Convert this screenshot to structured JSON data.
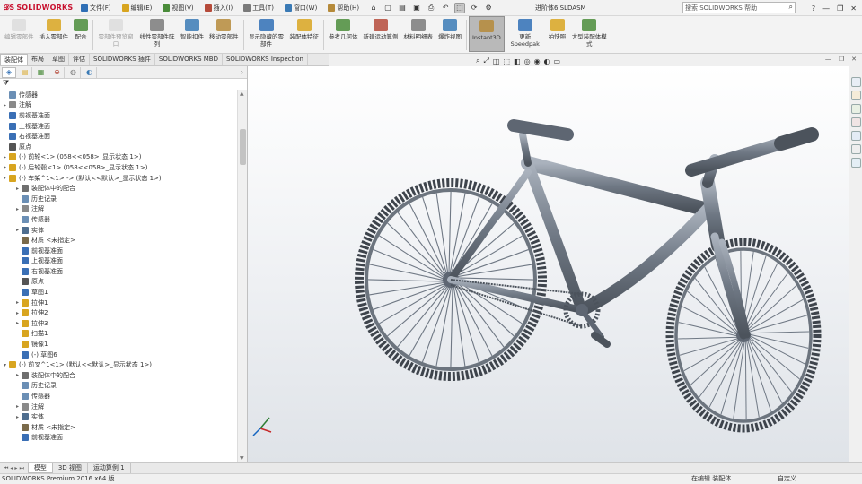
{
  "app": {
    "logo": "SOLIDWORKS",
    "doc_title": "进阶体6.SLDASM",
    "search_placeholder": "搜索 SOLIDWORKS 帮助",
    "accent": "#c8102e"
  },
  "menu": [
    "文件(F)",
    "编辑(E)",
    "视图(V)",
    "插入(I)",
    "工具(T)",
    "窗口(W)",
    "帮助(H)"
  ],
  "quickbar_icons": [
    "home-icon",
    "new-icon",
    "open-icon",
    "save-icon",
    "print-icon",
    "undo-icon",
    "select-icon",
    "rebuild-icon",
    "options-icon"
  ],
  "commands": [
    {
      "label": "编辑零部件",
      "icon": "edit-component-icon",
      "disabled": true
    },
    {
      "label": "插入零部件",
      "icon": "insert-component-icon"
    },
    {
      "label": "配合",
      "icon": "mate-icon"
    },
    {
      "label": "零部件预览窗口",
      "icon": "preview-window-icon",
      "disabled": true
    },
    {
      "label": "线性零部件阵列",
      "icon": "pattern-icon"
    },
    {
      "label": "智能扣件",
      "icon": "smart-fastener-icon"
    },
    {
      "label": "移动零部件",
      "icon": "move-component-icon"
    },
    {
      "label": "显示隐藏的零部件",
      "icon": "show-hidden-icon"
    },
    {
      "label": "装配体特征",
      "icon": "assembly-feature-icon"
    },
    {
      "label": "参考几何体",
      "icon": "reference-geometry-icon"
    },
    {
      "label": "新建运动算例",
      "icon": "motion-study-icon"
    },
    {
      "label": "材料明细表",
      "icon": "bom-icon"
    },
    {
      "label": "爆炸视图",
      "icon": "explode-icon"
    },
    {
      "label": "Instant3D",
      "icon": "instant3d-icon",
      "active": true
    },
    {
      "label": "更新 Speedpak",
      "icon": "speedpak-icon"
    },
    {
      "label": "拍快照",
      "icon": "snapshot-icon"
    },
    {
      "label": "大型装配体模式",
      "icon": "large-assembly-icon"
    }
  ],
  "tabs": [
    "装配体",
    "布局",
    "草图",
    "评估",
    "SOLIDWORKS 插件",
    "SOLIDWORKS MBD",
    "SOLIDWORKS Inspection"
  ],
  "hud_icons": [
    "search-view-icon",
    "zoom-fit-icon",
    "section-view-icon",
    "view-orientation-icon",
    "display-style-icon",
    "hide-show-icon",
    "appearance-icon",
    "scene-icon",
    "view-settings-icon"
  ],
  "panel_tabs": [
    "feature-manager-icon",
    "property-manager-icon",
    "configuration-manager-icon",
    "dimxpert-icon",
    "display-manager-icon",
    "appearance-tab-icon"
  ],
  "tree": [
    {
      "label": "传感器",
      "indent": 0,
      "icon": "sensor-icon",
      "exp": ""
    },
    {
      "label": "注解",
      "indent": 0,
      "icon": "annotation-icon",
      "exp": "▸"
    },
    {
      "label": "前视基准面",
      "indent": 0,
      "icon": "plane-icon",
      "exp": ""
    },
    {
      "label": "上视基准面",
      "indent": 0,
      "icon": "plane-icon",
      "exp": ""
    },
    {
      "label": "右视基准面",
      "indent": 0,
      "icon": "plane-icon",
      "exp": ""
    },
    {
      "label": "原点",
      "indent": 0,
      "icon": "origin-icon",
      "exp": ""
    },
    {
      "label": "(-) 前轮<1> (058<<058>_显示状态 1>)",
      "indent": 0,
      "icon": "part-icon",
      "exp": "▸"
    },
    {
      "label": "(-) 后轮毂<1> (058<<058>_显示状态 1>)",
      "indent": 0,
      "icon": "part-icon",
      "exp": "▸"
    },
    {
      "label": "(-) 车架^1<1> -> (默认<<默认>_显示状态 1>)",
      "indent": 0,
      "icon": "subassembly-icon",
      "exp": "▾"
    },
    {
      "label": "装配体中的配合",
      "indent": 1,
      "icon": "mates-folder-icon",
      "exp": "▸"
    },
    {
      "label": "历史记录",
      "indent": 1,
      "icon": "history-icon",
      "exp": ""
    },
    {
      "label": "注解",
      "indent": 1,
      "icon": "annotation-icon",
      "exp": "▸"
    },
    {
      "label": "传感器",
      "indent": 1,
      "icon": "sensor-icon",
      "exp": ""
    },
    {
      "label": "实体",
      "indent": 1,
      "icon": "solid-bodies-icon",
      "exp": "▸"
    },
    {
      "label": "材质 <未指定>",
      "indent": 1,
      "icon": "material-icon",
      "exp": ""
    },
    {
      "label": "前视基准面",
      "indent": 1,
      "icon": "plane-icon",
      "exp": ""
    },
    {
      "label": "上视基准面",
      "indent": 1,
      "icon": "plane-icon",
      "exp": ""
    },
    {
      "label": "右视基准面",
      "indent": 1,
      "icon": "plane-icon",
      "exp": ""
    },
    {
      "label": "原点",
      "indent": 1,
      "icon": "origin-icon",
      "exp": ""
    },
    {
      "label": "草图1",
      "indent": 1,
      "icon": "sketch-icon",
      "exp": ""
    },
    {
      "label": "拉伸1",
      "indent": 1,
      "icon": "extrude-icon",
      "exp": "▸"
    },
    {
      "label": "拉伸2",
      "indent": 1,
      "icon": "extrude-icon",
      "exp": "▸"
    },
    {
      "label": "拉伸3",
      "indent": 1,
      "icon": "extrude-icon",
      "exp": "▸"
    },
    {
      "label": "扫描1",
      "indent": 1,
      "icon": "sweep-icon",
      "exp": ""
    },
    {
      "label": "镜像1",
      "indent": 1,
      "icon": "mirror-icon",
      "exp": ""
    },
    {
      "label": "(-) 草图6",
      "indent": 1,
      "icon": "sketch-icon",
      "exp": ""
    },
    {
      "label": "(-) 前叉^1<1> (默认<<默认>_显示状态 1>)",
      "indent": 0,
      "icon": "subassembly-icon",
      "exp": "▾"
    },
    {
      "label": "装配体中的配合",
      "indent": 1,
      "icon": "mates-folder-icon",
      "exp": "▸"
    },
    {
      "label": "历史记录",
      "indent": 1,
      "icon": "history-icon",
      "exp": ""
    },
    {
      "label": "传感器",
      "indent": 1,
      "icon": "sensor-icon",
      "exp": ""
    },
    {
      "label": "注解",
      "indent": 1,
      "icon": "annotation-icon",
      "exp": "▸"
    },
    {
      "label": "实体",
      "indent": 1,
      "icon": "solid-bodies-icon",
      "exp": "▸"
    },
    {
      "label": "材质 <未指定>",
      "indent": 1,
      "icon": "material-icon",
      "exp": ""
    },
    {
      "label": "前视基准面",
      "indent": 1,
      "icon": "plane-icon",
      "exp": ""
    }
  ],
  "bottom_tabs": [
    "模型",
    "3D 视图",
    "运动算例 1"
  ],
  "status": {
    "product": "SOLIDWORKS Premium 2016 x64 版",
    "mode": "在编辑 装配体",
    "units": "自定义"
  },
  "colors": {
    "model": "#5e6672",
    "model_light": "#9aa3ae",
    "tire": "#3e444c"
  }
}
